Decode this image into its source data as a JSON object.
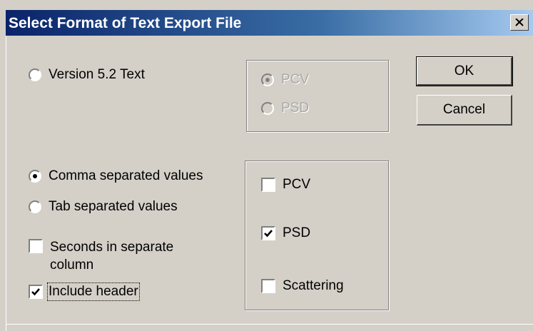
{
  "window": {
    "title": "Select Format of Text Export File"
  },
  "buttons": {
    "ok": "OK",
    "cancel": "Cancel"
  },
  "version_group": {
    "option_label": "Version 5.2 Text",
    "option_selected": false,
    "sub_options": [
      {
        "label": "PCV",
        "selected": true,
        "enabled": false
      },
      {
        "label": "PSD",
        "selected": false,
        "enabled": false
      }
    ]
  },
  "separator_group": {
    "options": [
      {
        "label": "Comma separated values",
        "selected": true
      },
      {
        "label": "Tab separated values",
        "selected": false
      }
    ],
    "seconds_column": {
      "label_line1": "Seconds in separate",
      "label_line2": "column",
      "checked": false
    },
    "include_header": {
      "label": "Include header",
      "checked": true
    }
  },
  "data_group": {
    "items": [
      {
        "label": "PCV",
        "checked": false
      },
      {
        "label": "PSD",
        "checked": true
      },
      {
        "label": "Scattering",
        "checked": false
      }
    ]
  },
  "icons": [
    "close-icon",
    "checkmark-icon"
  ]
}
